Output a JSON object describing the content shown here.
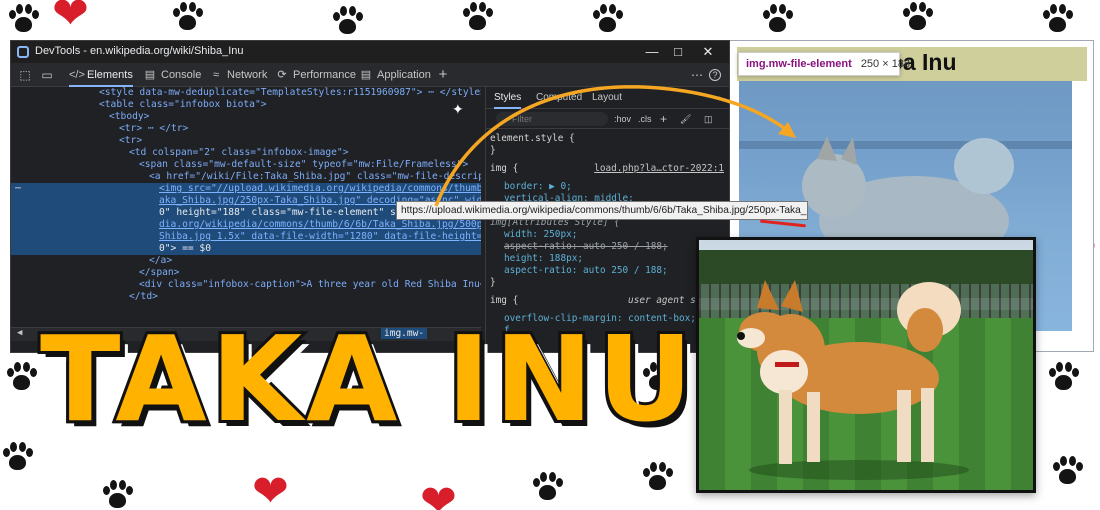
{
  "devtools": {
    "window_title": "DevTools - en.wikipedia.org/wiki/Shiba_Inu",
    "tabs": [
      {
        "label": "Elements",
        "icon": "code-brackets-icon"
      },
      {
        "label": "Console",
        "icon": "console-icon"
      },
      {
        "label": "Network",
        "icon": "wifi-icon"
      },
      {
        "label": "Performance",
        "icon": "performance-icon"
      },
      {
        "label": "Application",
        "icon": "application-icon"
      }
    ],
    "elements_lines": {
      "l0": "<style data-mw-deduplicate=\"TemplateStyles:r1151960987\"> ⋯ </style>",
      "l1": "<table class=\"infobox biota\">",
      "l2": "<tbody>",
      "l3": "<tr> ⋯ </tr>",
      "l4": "<tr>",
      "l5_tag": "<td colspan=\"2\" class=\"infobox-image\">",
      "l6": "<span class=\"mw-default-size\" typeof=\"mw:File/Frameless\">",
      "l7": "<a href=\"/wiki/File:Taka_Shiba.jpg\" class=\"mw-file-description\">",
      "l8": "<img src=\"//upload.wikimedia.org/wikipedia/commons/thumb/6/6b/T",
      "l9": "aka_Shiba.jpg/250px-Taka_Shiba.jpg\" decoding=\"async\" width=\"25",
      "l10": "0\" height=\"188\" class=\"mw-file-element\" srcset=\"//upload.wikime",
      "l11": "dia.org/wikipedia/commons/thumb/6/6b/Taka_Shiba.jpg/500px-Taka_",
      "l12": "Shiba.jpg 1.5x\" data-file-width=\"1280\" data-file-height=\"96",
      "l13": "0\"> == $0",
      "l14": "</a>",
      "l15": "</span>",
      "l16": "<div class=\"infobox-caption\">A three year old Red Shiba Inu</div>",
      "l17": "</td>"
    },
    "breadcrumb": "img.mw-"
  },
  "styles": {
    "tabs": [
      "Styles",
      "Computed",
      "Layout"
    ],
    "filter_placeholder": "Filter",
    "filter_tools": [
      ":hov",
      ".cls"
    ],
    "lines": {
      "s0": "element.style {",
      "s1": "}",
      "s2": "img {",
      "s2_src": "load.php?la…ctor-2022:1",
      "s3": "border: ▶ 0;",
      "s4": "vertical-align: middle;",
      "s5": "img[Attributes Style] {",
      "s6": "width: 250px;",
      "s7": "aspect-ratio: auto 250 / 188;",
      "s8": "height: 188px;",
      "s9": "aspect-ratio: auto 250 / 188;",
      "s10": "}",
      "s11": "img {",
      "s11_src": "user agent styles",
      "s12": "overflow-clip-margin: content-box;",
      "s13": "f"
    }
  },
  "tooltip": "https://upload.wikimedia.org/wikipedia/commons/thumb/6/6b/Taka_Shiba.jpg/250px-Taka_Shiba.jpg",
  "wiki": {
    "title": "Shiba Inu",
    "hover_tag": "img.mw-file-element",
    "hover_size": "250 × 188"
  },
  "overlay_title": "TAKA INU",
  "colors": {
    "title_fill": "#ffb300",
    "devtools_bg": "#202124",
    "selection": "#1f4b7a",
    "arrow": "#f5a623",
    "heart": "#d81e2a"
  }
}
